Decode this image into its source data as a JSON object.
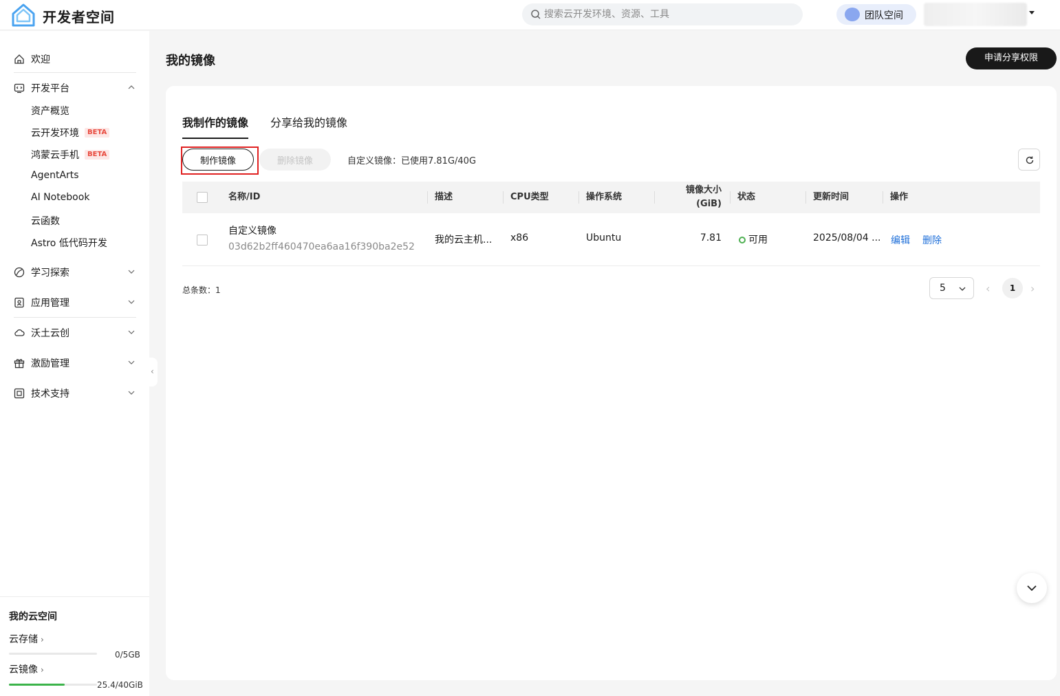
{
  "header": {
    "brand": "开发者空间",
    "search_placeholder": "搜索云开发环境、资源、工具",
    "team_label": "团队空间"
  },
  "sidebar": {
    "welcome": "欢迎",
    "dev_platform": "开发平台",
    "dev_items": [
      {
        "label": "资产概览"
      },
      {
        "label": "云开发环境",
        "badge": "BETA"
      },
      {
        "label": "鸿蒙云手机",
        "badge": "BETA"
      },
      {
        "label": "AgentArts"
      },
      {
        "label": "AI Notebook"
      },
      {
        "label": "云函数"
      },
      {
        "label": "Astro 低代码开发"
      }
    ],
    "learn": "学习探索",
    "app_mgmt": "应用管理",
    "wotu": "沃土云创",
    "incentive": "激励管理",
    "support": "技术支持",
    "my_cloud_space": "我的云空间",
    "storage_label": "云存储",
    "storage_value": "0/5GB",
    "storage_fraction": 0.0,
    "image_label": "云镜像",
    "image_value": "25.4/40GiB",
    "image_fraction": 0.635
  },
  "main": {
    "page_title": "我的镜像",
    "apply_button": "申请分享权限",
    "tabs": [
      "我制作的镜像",
      "分享给我的镜像"
    ],
    "make_button": "制作镜像",
    "delete_button": "删除镜像",
    "usage": "自定义镜像：已使用7.81G/40G",
    "table": {
      "headers": {
        "name": "名称/ID",
        "desc": "描述",
        "cpu": "CPU类型",
        "os": "操作系统",
        "size_line1": "镜像大小",
        "size_line2": "(GiB)",
        "status": "状态",
        "updated": "更新时间",
        "actions": "操作"
      },
      "rows": [
        {
          "name": "自定义镜像",
          "id": "03d62b2ff460470ea6aa16f390ba2e52",
          "desc": "我的云主机...",
          "cpu": "x86",
          "os": "Ubuntu",
          "size": "7.81",
          "status": "可用",
          "updated": "2025/08/04 ...",
          "edit": "编辑",
          "delete": "删除"
        }
      ]
    },
    "total": "总条数：1",
    "page_size": "5",
    "current_page": "1"
  },
  "colors": {
    "primary_dark": "#191919",
    "link": "#1e6fd9",
    "status_ok": "#4caf50",
    "beta": "#e84a3e",
    "highlight": "#e02020"
  }
}
